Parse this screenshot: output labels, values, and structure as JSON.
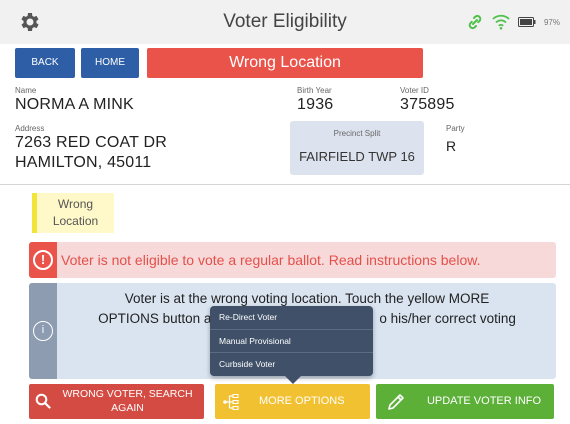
{
  "header": {
    "title": "Voter Eligibility",
    "battery_percent": "97%",
    "icons": [
      "gear-icon",
      "link-icon",
      "wifi-icon",
      "battery-icon"
    ]
  },
  "nav": {
    "back_label": "BACK",
    "home_label": "HOME",
    "alert_text": "Wrong Location"
  },
  "voter": {
    "name_label": "Name",
    "name": "NORMA A MINK",
    "birth_year_label": "Birth Year",
    "birth_year": "1936",
    "voter_id_label": "Voter ID",
    "voter_id": "375895",
    "address_label": "Address",
    "address_line1": "7263 RED COAT DR",
    "address_line2": "HAMILTON, 45011",
    "precinct_label": "Precinct Split",
    "precinct": "FAIRFIELD TWP 16",
    "party_label": "Party",
    "party": "R"
  },
  "status": {
    "tag_line1": "Wrong",
    "tag_line2": "Location",
    "error_message": "Voter is not eligible to vote a regular ballot. Read instructions below.",
    "info_line1": "Voter is at the wrong voting location. Touch the yellow MORE",
    "info_line2_start": "OPTIONS button a",
    "info_line2_end": "o his/her correct voting"
  },
  "more_options_menu": {
    "items": [
      "Re-Direct Voter",
      "Manual Provisional",
      "Curbside Voter"
    ]
  },
  "actions": {
    "wrong_voter_line1": "WRONG VOTER, SEARCH",
    "wrong_voter_line2": "AGAIN",
    "more_options": "MORE OPTIONS",
    "update_voter": "UPDATE VOTER INFO"
  },
  "colors": {
    "primary_blue": "#2e5ea6",
    "alert_red": "#e9534a",
    "warning_yellow": "#f1c132",
    "success_green": "#5cb038",
    "info_blue_bg": "#d9e4f0"
  }
}
